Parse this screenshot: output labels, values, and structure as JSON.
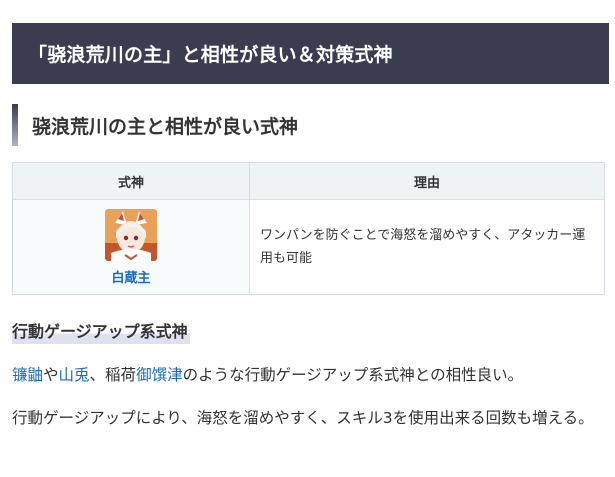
{
  "h2_title": "「骁浪荒川の主」と相性が良い＆対策式神",
  "h3_title": "骁浪荒川の主と相性が良い式神",
  "table": {
    "headers": [
      "式神",
      "理由"
    ],
    "rows": [
      {
        "name": "白蔵主",
        "reason": "ワンパンを防ぐことで海怒を溜めやすく、アタッカー運用も可能"
      }
    ]
  },
  "h4_title": "行動ゲージアップ系式神",
  "paragraph1": {
    "link1": "镰鼬",
    "text1": "や",
    "link2": "山兎",
    "text2": "、稲荷",
    "link3": "御馔津",
    "text3": "のような行動ゲージアップ系式神との相性良い。"
  },
  "paragraph2": "行動ゲージアップにより、海怒を溜めやすく、スキル3を使用出来る回数も増える。",
  "colors": {
    "header_bg": "#3a3d4f",
    "link": "#1a6bbf",
    "table_header_bg": "#eef4f4"
  }
}
